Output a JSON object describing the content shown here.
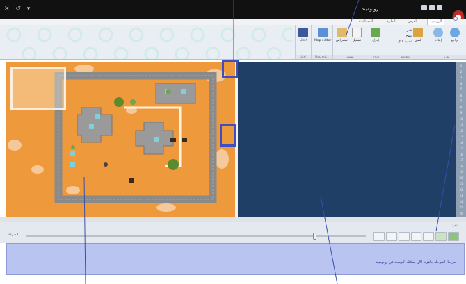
{
  "titlebar": {
    "title": "روبوميند",
    "controls": "✕ ↺ ▾"
  },
  "ribbon": {
    "tabs": [
      {
        "label": "الرئيسية",
        "active": true
      },
      {
        "label": "العرض",
        "active": false
      },
      {
        "label": "النظرة",
        "active": false
      },
      {
        "label": "المساعدة",
        "active": false
      }
    ],
    "buttons": {
      "undo": "تراجع",
      "redo": "إعادة",
      "paste": "لصق",
      "cut": "قص",
      "copy": "نسخ",
      "select_all": "تحديد الكل",
      "add": "إدراج",
      "run": "تشغيل",
      "help": "استعراض",
      "map_editor": "Map editor",
      "like": "Like!"
    },
    "groups": {
      "edit": "تحرير",
      "clipboard": "الحافظة",
      "insert": "إدراج",
      "run": "تشغيل",
      "map": "Map edi...",
      "like": "Like!"
    }
  },
  "speed": {
    "label": "السرعة",
    "value": 0.85
  },
  "message": {
    "text": "مرحبا. المرحلة جاهزة، الآن يمكنك البرمجة في روبوميند"
  },
  "corner_label": "تنفيذ",
  "line_numbers": [
    "1",
    "2",
    "3",
    "4",
    "5",
    "6",
    "7",
    "8",
    "9",
    "10",
    "11",
    "12",
    "13",
    "14",
    "15",
    "16",
    "17",
    "18",
    "19",
    "20",
    "21",
    "22",
    "23",
    "24",
    "25",
    "26"
  ],
  "colors": {
    "map_bg": "#ee9a3c",
    "code_bg": "#1f3f66",
    "message_bg": "#b9c4f1",
    "highlight": "#3f4fc2"
  }
}
